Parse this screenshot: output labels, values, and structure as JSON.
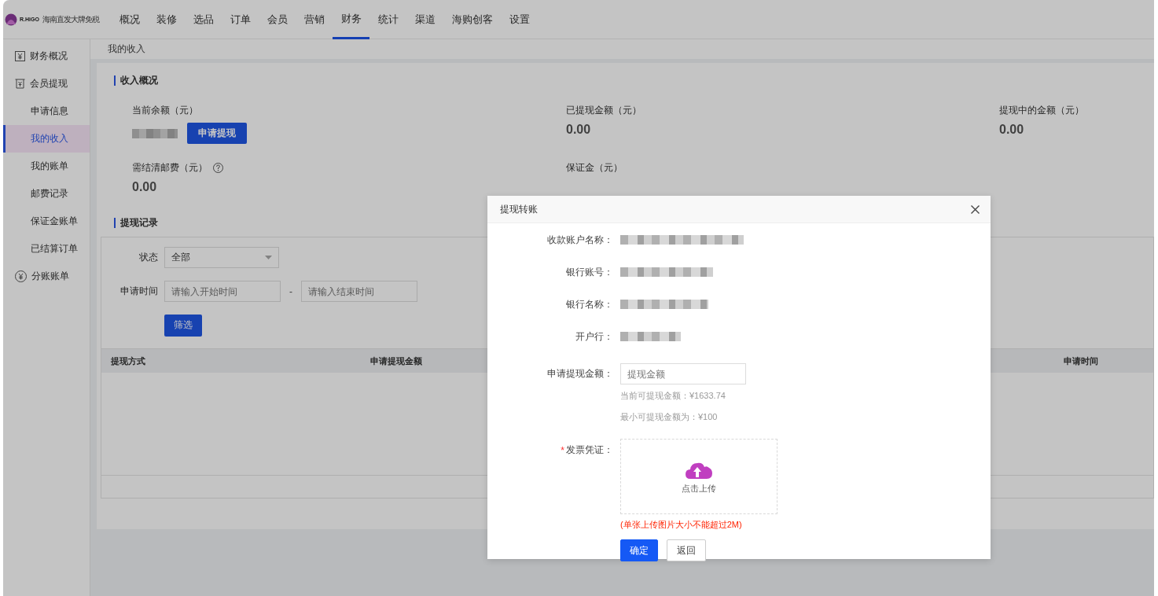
{
  "logo": {
    "brand": "R.HiGO",
    "tagline": "海南直发大牌免税"
  },
  "nav": [
    {
      "label": "概况",
      "selected": false
    },
    {
      "label": "装修",
      "selected": false
    },
    {
      "label": "选品",
      "selected": false
    },
    {
      "label": "订单",
      "selected": false
    },
    {
      "label": "会员",
      "selected": false
    },
    {
      "label": "营销",
      "selected": false
    },
    {
      "label": "财务",
      "selected": true
    },
    {
      "label": "统计",
      "selected": false
    },
    {
      "label": "渠道",
      "selected": false
    },
    {
      "label": "海购创客",
      "selected": false
    },
    {
      "label": "设置",
      "selected": false
    }
  ],
  "sidebar": [
    {
      "label": "财务概况",
      "selected": false
    },
    {
      "label": "会员提现",
      "selected": false,
      "children": [
        {
          "label": "申请信息",
          "selected": false
        },
        {
          "label": "我的收入",
          "selected": true
        },
        {
          "label": "我的账单",
          "selected": false
        },
        {
          "label": "邮费记录",
          "selected": false
        },
        {
          "label": "保证金账单",
          "selected": false
        },
        {
          "label": "已结算订单",
          "selected": false
        }
      ]
    },
    {
      "label": "分账账单",
      "selected": false
    }
  ],
  "breadcrumb": "我的收入",
  "overview": {
    "title": "收入概况",
    "stats": [
      {
        "kind": "balance",
        "label": "当前余额（元）",
        "button": "申请提现"
      },
      {
        "kind": "amount",
        "label": "已提现金额（元）",
        "value": "0.00"
      },
      {
        "kind": "amount",
        "label": "提现中的金额（元）",
        "value": "0.00"
      },
      {
        "kind": "help",
        "label": "需结清邮费（元）",
        "value": "0.00"
      },
      {
        "kind": "label",
        "label": "保证金（元）"
      }
    ]
  },
  "records": {
    "title": "提现记录",
    "status_label": "状态",
    "status_value": "全部",
    "time_label": "申请时间",
    "start_placeholder": "请输入开始时间",
    "separator": "-",
    "end_placeholder": "请输入结束时间",
    "filter_button": "筛选",
    "columns": [
      "提现方式",
      "申请提现金额",
      "申请时间"
    ]
  },
  "dialog": {
    "title": "提现转账",
    "fields": [
      "收款账户名称：",
      "银行账号：",
      "银行名称：",
      "开户行："
    ],
    "amount": {
      "label": "申请提现金额：",
      "placeholder": "提现金额",
      "available": "当前可提现金额：¥1633.74",
      "minimum": "最小可提现金额为：¥100"
    },
    "upload": {
      "required_mark": "*",
      "label": "发票凭证：",
      "text": "点击上传",
      "note": "(单张上传图片大小不能超过2M)"
    },
    "buttons": [
      {
        "label": "确定",
        "kind": "primary"
      },
      {
        "label": "返回",
        "kind": "default"
      }
    ]
  }
}
